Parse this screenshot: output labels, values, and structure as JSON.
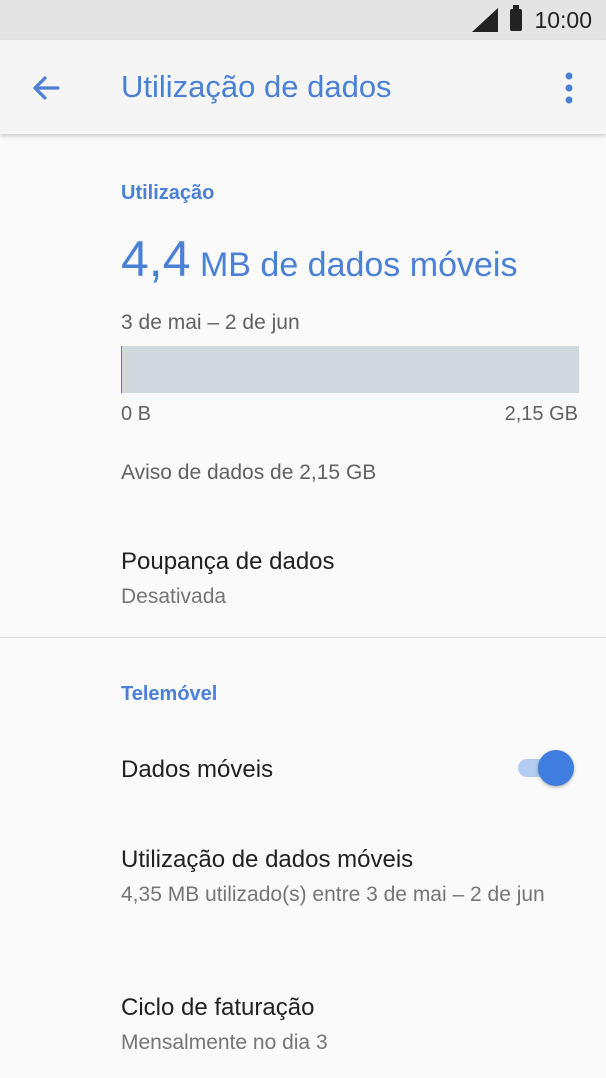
{
  "status_bar": {
    "time": "10:00",
    "signal_icon": "signal-icon",
    "battery_icon": "battery-icon"
  },
  "app_bar": {
    "title": "Utilização de dados",
    "back_icon": "arrow-back-icon",
    "menu_icon": "more-vert-icon"
  },
  "usage": {
    "section_title": "Utilização",
    "amount": "4,4",
    "amount_suffix": " MB de dados móveis",
    "period": "3 de mai – 2 de jun",
    "bar_min_label": "0 B",
    "bar_max_label": "2,15 GB",
    "bar_fill_fraction": 0.002,
    "warning": "Aviso de dados de 2,15 GB"
  },
  "data_saver": {
    "title": "Poupança de dados",
    "status": "Desativada"
  },
  "mobile": {
    "section_title": "Telemóvel",
    "mobile_data": {
      "title": "Dados móveis",
      "enabled": true
    },
    "mobile_usage": {
      "title": "Utilização de dados móveis",
      "summary": "4,35 MB utilizado(s) entre 3 de mai – 2 de jun"
    },
    "billing_cycle": {
      "title": "Ciclo de faturação",
      "summary": "Mensalmente no dia 3"
    }
  },
  "colors": {
    "accent": "#4a80d6",
    "bar_bg": "#cfd8dc",
    "toggle_thumb": "#3f7ee0",
    "toggle_track": "#b3cdf2"
  }
}
